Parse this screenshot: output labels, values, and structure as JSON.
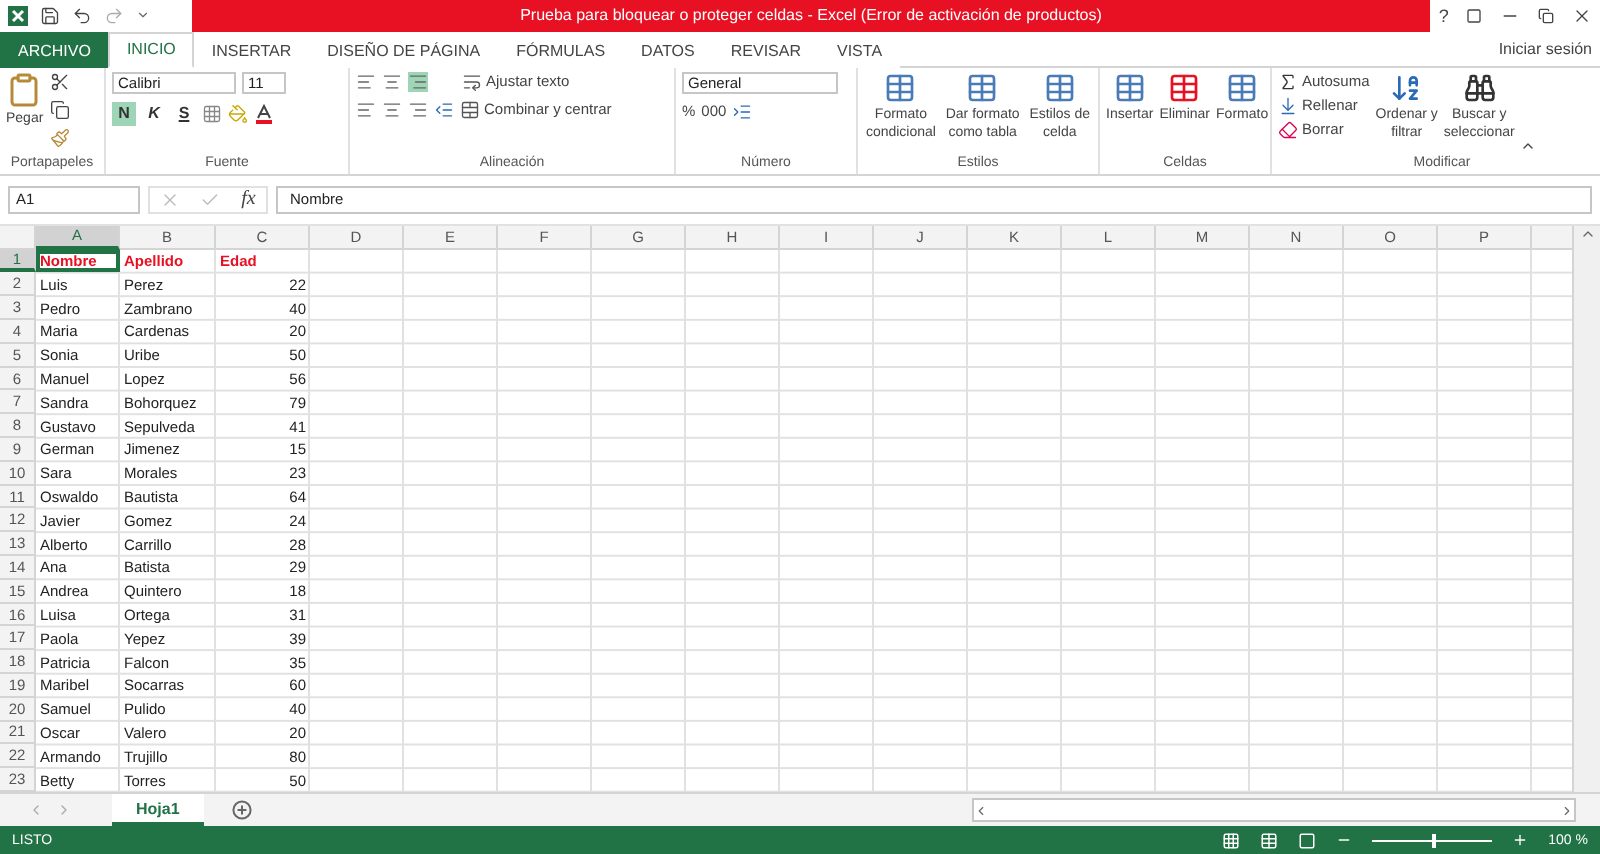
{
  "window": {
    "title": "Prueba para bloquear o proteger celdas -  Excel (Error de activación de productos)",
    "help": "?"
  },
  "ribbon_tabs": [
    {
      "label": "ARCHIVO",
      "kind": "file",
      "selected": false
    },
    {
      "label": "INICIO",
      "kind": "tab",
      "selected": true
    },
    {
      "label": "INSERTAR",
      "kind": "tab",
      "selected": false
    },
    {
      "label": "DISEÑO DE PÁGINA",
      "kind": "tab",
      "selected": false
    },
    {
      "label": "FÓRMULAS",
      "kind": "tab",
      "selected": false
    },
    {
      "label": "DATOS",
      "kind": "tab",
      "selected": false
    },
    {
      "label": "REVISAR",
      "kind": "tab",
      "selected": false
    },
    {
      "label": "VISTA",
      "kind": "tab",
      "selected": false
    }
  ],
  "account": "Iniciar sesión",
  "ribbon": {
    "clipboard": {
      "paste": "Pegar",
      "label": "Portapapeles"
    },
    "font": {
      "name": "Calibri",
      "size": "11",
      "styles": [
        {
          "label": "N",
          "selected": true
        },
        {
          "label": "K",
          "selected": false
        },
        {
          "label": "S",
          "selected": false
        }
      ],
      "label": "Fuente"
    },
    "alignment": {
      "wrap": "Ajustar texto",
      "merge": "Combinar y centrar",
      "label": "Alineación"
    },
    "number": {
      "format": "General",
      "percent": "%",
      "thousands": "000",
      "label": "Número"
    },
    "styles": {
      "buttons": [
        "Formato\ncondicional",
        "Dar formato\ncomo tabla",
        "Estilos de\ncelda"
      ],
      "label": "Estilos"
    },
    "cells": {
      "buttons": [
        "Insertar",
        "Eliminar",
        "Formato"
      ],
      "label": "Celdas"
    },
    "editing": {
      "autosum": "Autosuma",
      "fill": "Rellenar",
      "clear": "Borrar",
      "sort": "Ordenar y\nfiltrar",
      "find": "Buscar y\nseleccionar",
      "label": "Modificar"
    }
  },
  "formula_bar": {
    "name_box": "A1",
    "fx": "fx",
    "value": "Nombre"
  },
  "sheet": {
    "columns": [
      {
        "label": "A",
        "selected": true
      },
      {
        "label": "B",
        "selected": false
      },
      {
        "label": "C",
        "selected": false
      },
      {
        "label": "D",
        "selected": false
      },
      {
        "label": "E",
        "selected": false
      },
      {
        "label": "F",
        "selected": false
      },
      {
        "label": "G",
        "selected": false
      },
      {
        "label": "H",
        "selected": false
      },
      {
        "label": "I",
        "selected": false
      },
      {
        "label": "J",
        "selected": false
      },
      {
        "label": "K",
        "selected": false
      },
      {
        "label": "L",
        "selected": false
      },
      {
        "label": "M",
        "selected": false
      },
      {
        "label": "N",
        "selected": false
      },
      {
        "label": "O",
        "selected": false
      },
      {
        "label": "P",
        "selected": false
      }
    ],
    "rows": [
      {
        "number": "1",
        "kind": "header",
        "selected": true,
        "cells": [
          "Nombre",
          "Apellido",
          "Edad"
        ]
      },
      {
        "number": "2",
        "kind": "data",
        "selected": false,
        "cells": [
          "Luis",
          "Perez",
          "22"
        ]
      },
      {
        "number": "3",
        "kind": "data",
        "selected": false,
        "cells": [
          "Pedro",
          "Zambrano",
          "40"
        ]
      },
      {
        "number": "4",
        "kind": "data",
        "selected": false,
        "cells": [
          "Maria",
          "Cardenas",
          "20"
        ]
      },
      {
        "number": "5",
        "kind": "data",
        "selected": false,
        "cells": [
          "Sonia",
          "Uribe",
          "50"
        ]
      },
      {
        "number": "6",
        "kind": "data",
        "selected": false,
        "cells": [
          "Manuel",
          "Lopez",
          "56"
        ]
      },
      {
        "number": "7",
        "kind": "data",
        "selected": false,
        "cells": [
          "Sandra",
          "Bohorquez",
          "79"
        ]
      },
      {
        "number": "8",
        "kind": "data",
        "selected": false,
        "cells": [
          "Gustavo",
          "Sepulveda",
          "41"
        ]
      },
      {
        "number": "9",
        "kind": "data",
        "selected": false,
        "cells": [
          "German",
          "Jimenez",
          "15"
        ]
      },
      {
        "number": "10",
        "kind": "data",
        "selected": false,
        "cells": [
          "Sara",
          "Morales",
          "23"
        ]
      },
      {
        "number": "11",
        "kind": "data",
        "selected": false,
        "cells": [
          "Oswaldo",
          "Bautista",
          "64"
        ]
      },
      {
        "number": "12",
        "kind": "data",
        "selected": false,
        "cells": [
          "Javier",
          "Gomez",
          "24"
        ]
      },
      {
        "number": "13",
        "kind": "data",
        "selected": false,
        "cells": [
          "Alberto",
          "Carrillo",
          "28"
        ]
      },
      {
        "number": "14",
        "kind": "data",
        "selected": false,
        "cells": [
          "Ana",
          "Batista",
          "29"
        ]
      },
      {
        "number": "15",
        "kind": "data",
        "selected": false,
        "cells": [
          "Andrea",
          "Quintero",
          "18"
        ]
      },
      {
        "number": "16",
        "kind": "data",
        "selected": false,
        "cells": [
          "Luisa",
          "Ortega",
          "31"
        ]
      },
      {
        "number": "17",
        "kind": "data",
        "selected": false,
        "cells": [
          "Paola",
          "Yepez",
          "39"
        ]
      },
      {
        "number": "18",
        "kind": "data",
        "selected": false,
        "cells": [
          "Patricia",
          "Falcon",
          "35"
        ]
      },
      {
        "number": "19",
        "kind": "data",
        "selected": false,
        "cells": [
          "Maribel",
          "Socarras",
          "60"
        ]
      },
      {
        "number": "20",
        "kind": "data",
        "selected": false,
        "cells": [
          "Samuel",
          "Pulido",
          "40"
        ]
      },
      {
        "number": "21",
        "kind": "data",
        "selected": false,
        "cells": [
          "Oscar",
          "Valero",
          "20"
        ]
      },
      {
        "number": "22",
        "kind": "data",
        "selected": false,
        "cells": [
          "Armando",
          "Trujillo",
          "80"
        ]
      },
      {
        "number": "23",
        "kind": "data",
        "selected": false,
        "cells": [
          "Betty",
          "Torres",
          "50"
        ]
      }
    ]
  },
  "sheet_tabs": [
    {
      "label": "Hoja1",
      "selected": true
    }
  ],
  "status_bar": {
    "text": "LISTO",
    "zoom": "100 %",
    "zoom_slider": {
      "level": 0.5
    }
  }
}
